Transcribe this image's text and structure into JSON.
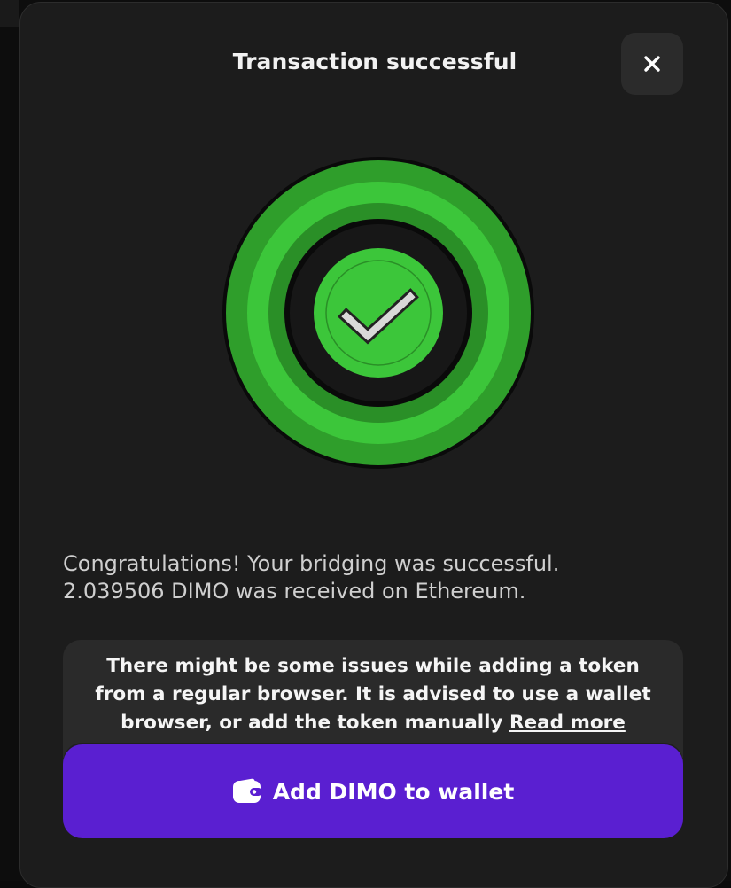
{
  "modal": {
    "title": "Transaction successful",
    "close_label": "×"
  },
  "message": {
    "line1": "Congratulations! Your bridging was successful.",
    "line2": "2.039506 DIMO was received on Ethereum."
  },
  "warning": {
    "text": "There might be some issues while adding a token from a regular browser. It is advised to use a wallet browser, or add the token manually",
    "link_label": "Read more"
  },
  "add_button": {
    "label": "Add DIMO to wallet"
  },
  "icons": {
    "close": "close-icon",
    "success": "check-circle-icon",
    "wallet": "wallet-icon"
  },
  "colors": {
    "modal_bg": "#1c1c1c",
    "success_green": "#3cc63a",
    "button_purple": "#5a1fd1",
    "warning_bg": "#2a2a2a"
  }
}
